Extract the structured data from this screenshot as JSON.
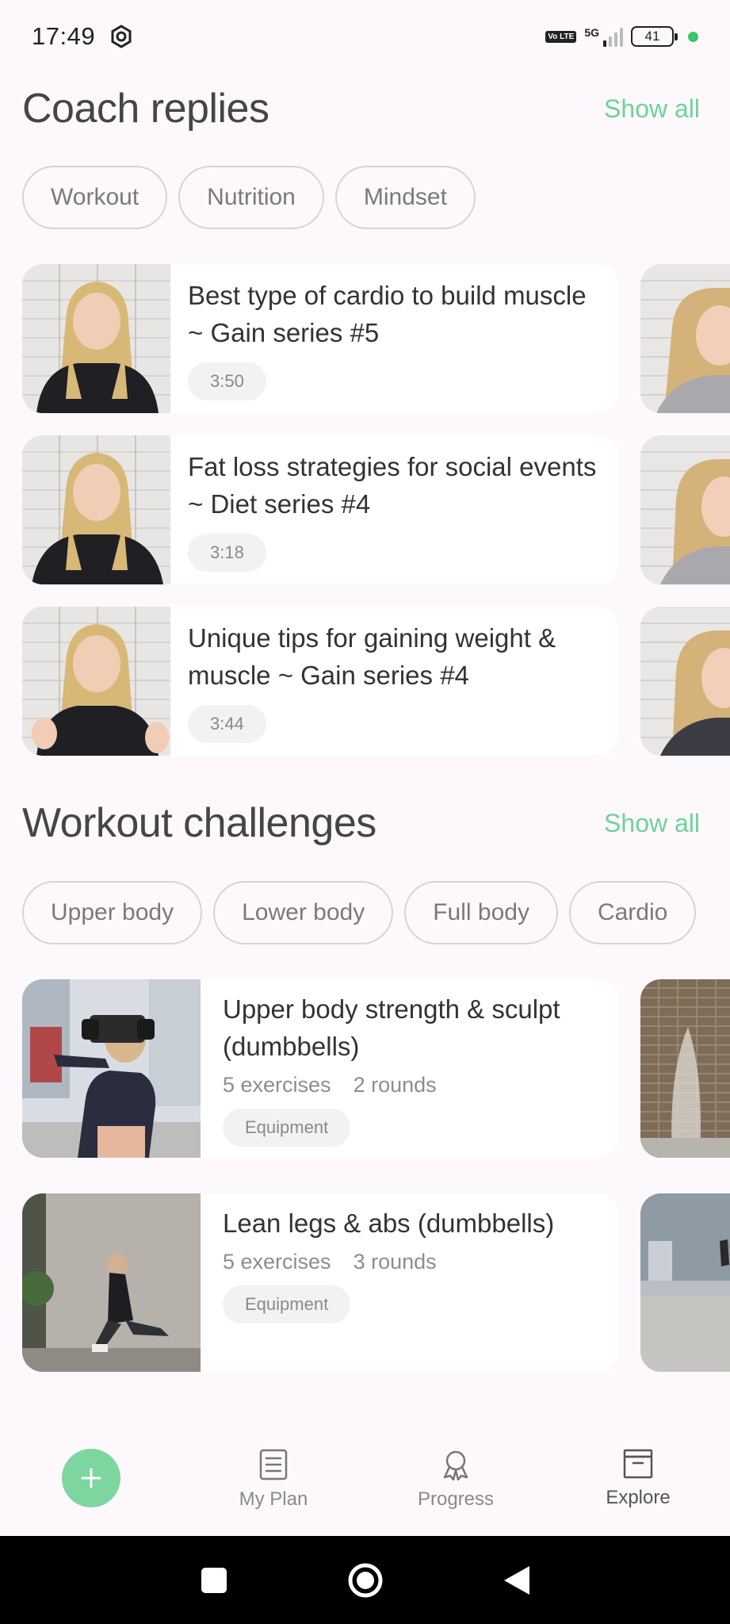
{
  "status_bar": {
    "time": "17:49",
    "volte": "Vo LTE",
    "network": "5G",
    "battery": "41"
  },
  "coach": {
    "title": "Coach replies",
    "show_all": "Show all",
    "chips": [
      "Workout",
      "Nutrition",
      "Mindset"
    ],
    "cards": [
      {
        "title": "Best type of cardio to build muscle ~ Gain series #5",
        "duration": "3:50"
      },
      {
        "title": "Fat loss strategies for social events ~ Diet series #4",
        "duration": "3:18"
      },
      {
        "title": "Unique tips for gaining weight & muscle ~ Gain series #4",
        "duration": "3:44"
      }
    ]
  },
  "challenges": {
    "title": "Workout challenges",
    "show_all": "Show all",
    "chips": [
      "Upper body",
      "Lower body",
      "Full body",
      "Cardio"
    ],
    "cards": [
      {
        "title": "Upper body strength & sculpt (dumbbells)",
        "exercises": "5 exercises",
        "rounds": "2 rounds",
        "tag": "Equipment"
      },
      {
        "title": "Lean legs & abs (dumbbells)",
        "exercises": "5 exercises",
        "rounds": "3 rounds",
        "tag": "Equipment"
      }
    ]
  },
  "nav": {
    "items": [
      {
        "label": "My Plan",
        "icon": "plan-icon"
      },
      {
        "label": "Progress",
        "icon": "award-icon"
      },
      {
        "label": "Explore",
        "icon": "archive-icon",
        "active": true
      }
    ]
  },
  "colors": {
    "accent": "#6dd39a",
    "fab": "#7dd6a0",
    "background": "#fdf8fc"
  }
}
